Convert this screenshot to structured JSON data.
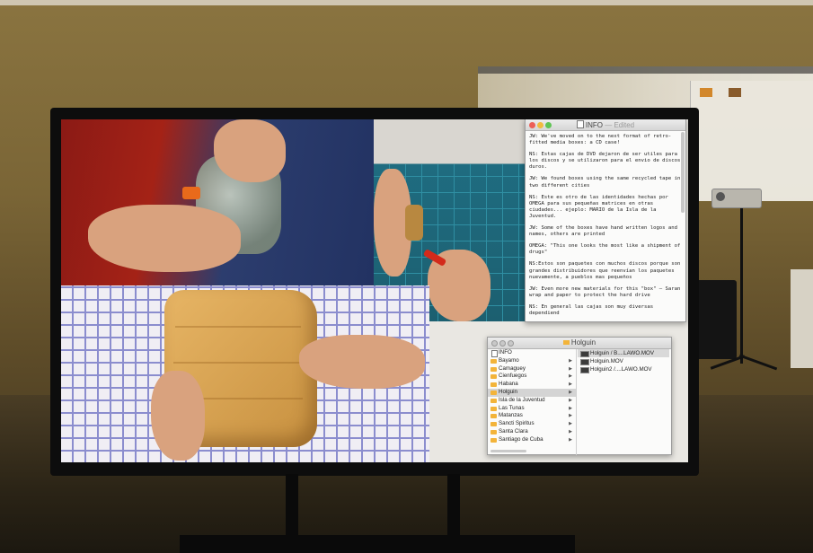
{
  "text_window": {
    "title": "INFO",
    "title_status": "— Edited",
    "paragraphs": [
      "JW: We've moved on to the next format of retro-fitted media boxes: a CD case!",
      "NS: Estas cajas de DVD dejaron de ser utiles para los discos y se utilizaron para el envio de discos duros.",
      "JW: We found boxes using the same recycled tape in two different cities",
      "NS: Este es otro de las identidades hechas por OMEGA para sus pequeñas matrices en otras ciudades... ejeplo: MARIO de la Isla de la Juventud.",
      "JW: Some of the boxes have hand written logos and names, others are printed",
      "OMEGA: \"This one looks the most like a shipment of drugs\"",
      "NS:Estos son paquetes con muchos discos porque son grandes distribuidores que reenvían los paquetes nuevamente, a pueblos mas pequeños",
      "JW: Even more new materials for this \"box\" — Saran wrap and paper to protect the hard drive",
      "NS: En general las cajas son muy diversas dependiend"
    ]
  },
  "finder_window": {
    "title": "Holguin",
    "folders": [
      {
        "label": "INFO",
        "kind": "doc"
      },
      {
        "label": "Bayamo",
        "kind": "folder"
      },
      {
        "label": "Camaguey",
        "kind": "folder"
      },
      {
        "label": "Cienfuegos",
        "kind": "folder"
      },
      {
        "label": "Habana",
        "kind": "folder"
      },
      {
        "label": "Holguin",
        "kind": "folder"
      },
      {
        "label": "Isla de la Juventud",
        "kind": "folder"
      },
      {
        "label": "Las Tunas",
        "kind": "folder"
      },
      {
        "label": "Matanzas",
        "kind": "folder"
      },
      {
        "label": "Sancti Spiritus",
        "kind": "folder"
      },
      {
        "label": "Santa Clara",
        "kind": "folder"
      },
      {
        "label": "Santiago de Cuba",
        "kind": "folder"
      }
    ],
    "selected_folder_index": 5,
    "files": [
      {
        "label": "Holguin / B....LAWO.MOV"
      },
      {
        "label": "Holguin.MOV"
      },
      {
        "label": "Holguin2 /....LAWO.MOV"
      }
    ],
    "arrow_glyph": "▶"
  },
  "colors": {
    "accent_tape_orange": "#d9a24d",
    "fabric_blue": "#3a3fb0",
    "cutter_red": "#d32a1b"
  }
}
